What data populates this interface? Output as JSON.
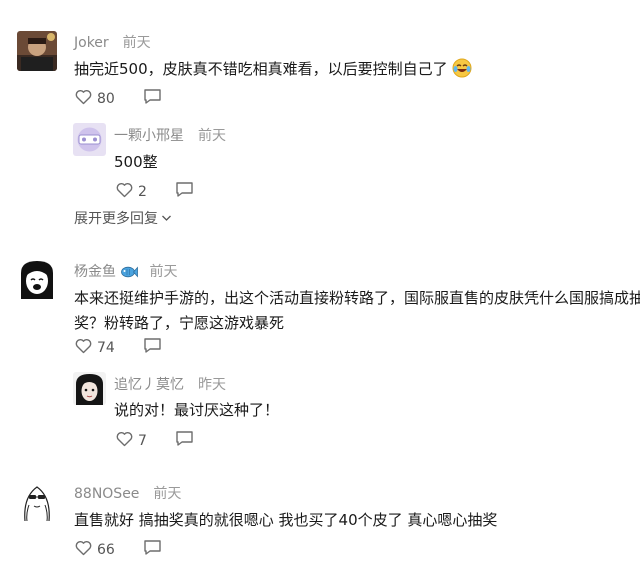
{
  "comments": [
    {
      "user": "Joker",
      "time": "前天",
      "text": "抽完近500，皮肤真不错吃相真难看，以后要控制自己了",
      "emoji": "laughing-with-tears",
      "likes": "80",
      "replies": [
        {
          "user": "一颗小邢星",
          "time": "前天",
          "text": "500整",
          "likes": "2"
        }
      ],
      "expand_label": "展开更多回复"
    },
    {
      "user": "杨金鱼",
      "user_badge": "fish-icon",
      "time": "前天",
      "text_line1": "本来还挺维护手游的，出这个活动直接粉转路了，国际服直售的皮肤凭什么国服搞成抽",
      "text_line2": "奖？粉转路了，宁愿这游戏暴死",
      "likes": "74",
      "replies": [
        {
          "user": "追忆丿莫忆",
          "time": "昨天",
          "text": "说的对！最讨厌这种了！",
          "likes": "7"
        }
      ]
    },
    {
      "user": "88NOSee",
      "time": "前天",
      "text": "直售就好 搞抽奖真的就很嗯心 我也买了40个皮了 真心嗯心抽奖",
      "likes": "66"
    }
  ]
}
